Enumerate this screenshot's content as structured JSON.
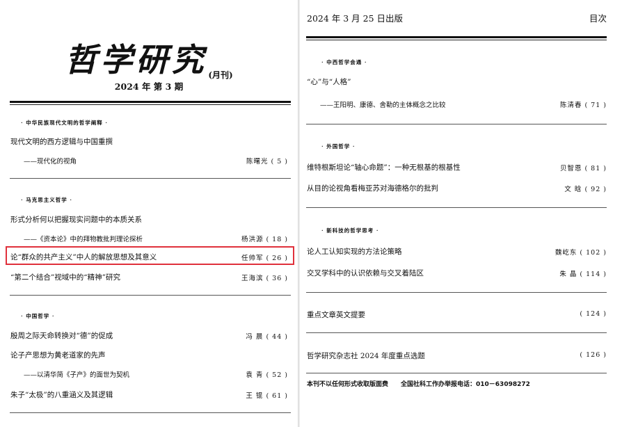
{
  "left_page": {
    "journal_title": "哲学研究",
    "journal_subtitle": "(月刊)",
    "issue_line": "2024 年 第 3 期",
    "sections": [
      {
        "heading": "· 中华民族现代文明的哲学阐释 ·",
        "articles": [
          {
            "title": "现代文明的西方逻辑与中国重撰",
            "subtitle": "——现代化的视角",
            "author": "陈曙光 ( 5 )"
          }
        ]
      },
      {
        "heading": "· 马克思主义哲学 ·",
        "articles": [
          {
            "title": "形式分析何以把握现实问题中的本质关系",
            "subtitle": "——《资本论》中的拜物教批判理论探析",
            "author": "杨洪源 ( 18 )"
          },
          {
            "title": "论“群众的共产主义”中人的解放思想及其意义",
            "author": "任帅军 ( 26 )"
          },
          {
            "title": "“第二个结合”视域中的“精神”研究",
            "author": "王海滨 ( 36 )"
          }
        ]
      },
      {
        "heading": "· 中国哲学 ·",
        "articles": [
          {
            "title": "殷周之际天命转换对“德”的促成",
            "author": "冯 晨 ( 44 )"
          },
          {
            "title": "论子产思想为黄老道家的先声",
            "subtitle": "——以清华简《子产》的面世为契机",
            "author": "袁 青 ( 52 )"
          },
          {
            "title": "朱子“太极”的八重涵义及其逻辑",
            "author": "王 锟 ( 61 )"
          }
        ]
      }
    ]
  },
  "right_page": {
    "publish_date": "2024 年 3 月 25 日出版",
    "toc_label": "目次",
    "sections": [
      {
        "heading": "· 中西哲学会通 ·",
        "articles": [
          {
            "title": "“心”与“人格”",
            "subtitle": "——王阳明、康德、舍勒的主体概念之比较",
            "author": "陈清春 ( 71 )"
          }
        ]
      },
      {
        "heading": "· 外国哲学 ·",
        "articles": [
          {
            "title": "维特根斯坦论“轴心命题”：一种无根基的根基性",
            "author": "贝智恩 ( 81 )"
          },
          {
            "title": "从目的论视角看梅亚苏对海德格尔的批判",
            "author": "文 晗 ( 92 )"
          }
        ]
      },
      {
        "heading": "· 新科技的哲学思考 ·",
        "articles": [
          {
            "title": "论人工认知实现的方法论策略",
            "author": "魏屹东 ( 102 )"
          },
          {
            "title": "交叉学科中的认识依赖与交叉着陆区",
            "author": "朱 晶 ( 114 )"
          }
        ]
      }
    ],
    "extras": [
      {
        "title": "重点文章英文提要",
        "page": "( 124 )"
      },
      {
        "title": "哲学研究杂志社 2024 年度重点选题",
        "page": "( 126 )"
      }
    ],
    "footer": "本刊不以任何形式收取版面费　　全国社科工作办举报电话：010－63098272"
  },
  "highlight_color": "#e0303b"
}
